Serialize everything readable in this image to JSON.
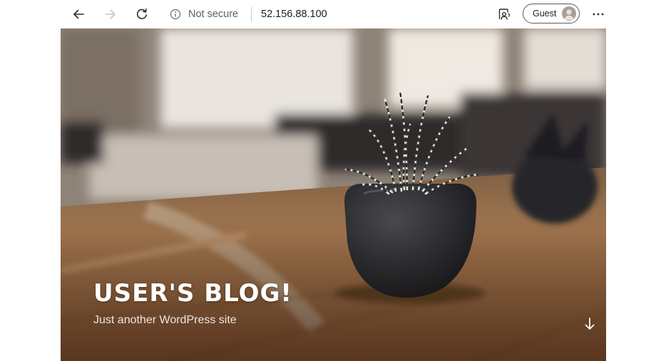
{
  "browser": {
    "security_label": "Not secure",
    "url": "52.156.88.100",
    "profile_label": "Guest",
    "icons": {
      "back": "arrow-left-icon",
      "forward": "arrow-right-icon",
      "reload": "reload-icon",
      "info": "info-icon",
      "reader": "read-aloud-icon",
      "avatar": "user-avatar-icon",
      "more": "more-horizontal-icon"
    }
  },
  "hero": {
    "title": "USER'S BLOG!",
    "tagline": "Just another WordPress site",
    "scroll_icon": "arrow-down-icon"
  },
  "colors": {
    "title_text": "#ffffff",
    "toolbar_bg": "#ffffff",
    "wood_tone": "#9a6b43",
    "pot": "#2c2d31"
  }
}
